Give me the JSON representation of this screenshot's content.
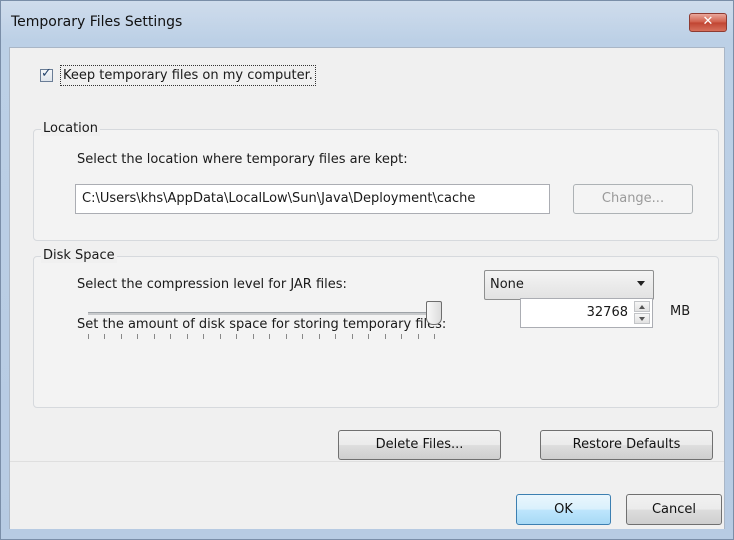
{
  "window": {
    "title": "Temporary Files Settings",
    "close_glyph": "✕"
  },
  "keep_files": {
    "label": "Keep temporary files on my computer.",
    "checked": true,
    "check_glyph": "✓"
  },
  "location": {
    "group_title": "Location",
    "description": "Select the location where temporary files are kept:",
    "path": "C:\\Users\\khs\\AppData\\LocalLow\\Sun\\Java\\Deployment\\cache",
    "change_button": {
      "label": "Change...",
      "enabled": false
    }
  },
  "disk_space": {
    "group_title": "Disk Space",
    "compression_label": "Select the compression level for JAR files:",
    "compression_value": "None",
    "amount_label": "Set the amount of disk space for storing temporary files:",
    "slider_level": 1.0,
    "amount_value": "32768",
    "unit": "MB"
  },
  "buttons": {
    "delete_files": "Delete Files...",
    "restore_defaults": "Restore Defaults",
    "ok": "OK",
    "cancel": "Cancel"
  },
  "colors": {
    "close_button": "#c9503d",
    "default_button_border": "#3c7fb1"
  }
}
